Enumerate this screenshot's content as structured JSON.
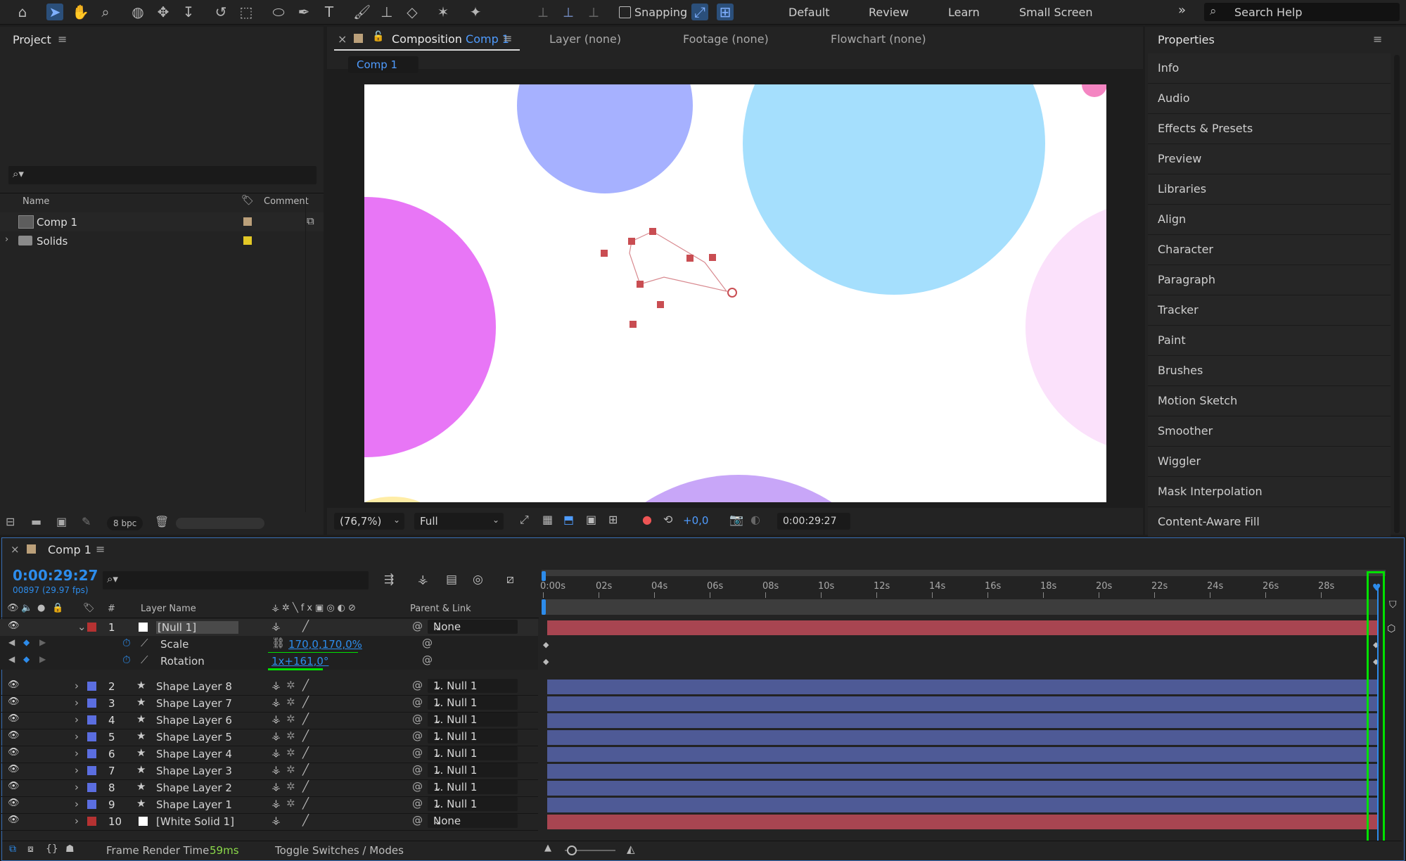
{
  "colors": {
    "accent": "#2d8ceb",
    "null_label": "#b53232",
    "shape_label": "#5b6ee0",
    "bar_red": "#a84551",
    "bar_blue": "#4e5a96",
    "highlight_green": "#00e000"
  },
  "toolbar": {
    "snapping_label": "Snapping",
    "workspaces": [
      "Default",
      "Review",
      "Learn",
      "Small Screen"
    ],
    "search_placeholder": "Search Help"
  },
  "project": {
    "title": "Project",
    "col_name": "Name",
    "col_comment": "Comment",
    "items": [
      {
        "name": "Comp 1",
        "icon": "composition-icon"
      },
      {
        "name": "Solids",
        "icon": "folder-icon"
      }
    ],
    "bpc": "8 bpc"
  },
  "composition": {
    "close": "×",
    "tab_prefix": "Composition",
    "tab_name": "Comp 1",
    "tabs": [
      "Layer (none)",
      "Footage (none)",
      "Flowchart (none)"
    ],
    "breadcrumb": "Comp 1",
    "zoom": "(76,7%)",
    "resolution": "Full",
    "exposure": "+0,0",
    "timecode": "0:00:29:27"
  },
  "properties": {
    "title": "Properties",
    "items": [
      "Info",
      "Audio",
      "Effects & Presets",
      "Preview",
      "Libraries",
      "Align",
      "Character",
      "Paragraph",
      "Tracker",
      "Paint",
      "Brushes",
      "Motion Sketch",
      "Smoother",
      "Wiggler",
      "Mask Interpolation",
      "Content-Aware Fill"
    ]
  },
  "timeline": {
    "close": "×",
    "comp_name": "Comp 1",
    "current_time": "0:00:29:27",
    "frame_info": "00897 (29.97 fps)",
    "col_num": "#",
    "col_layer_name": "Layer Name",
    "col_parent": "Parent & Link",
    "ruler": [
      "0:00s",
      "02s",
      "04s",
      "06s",
      "08s",
      "10s",
      "12s",
      "14s",
      "16s",
      "18s",
      "20s",
      "22s",
      "24s",
      "26s",
      "28s"
    ],
    "scale_label": "Scale",
    "scale_value": "170,0,170,0%",
    "rotation_label": "Rotation",
    "rotation_value": "1x+161,0°",
    "layers": [
      {
        "num": "1",
        "name": "[Null 1]",
        "parent": "None",
        "color": "#b53232"
      },
      {
        "num": "2",
        "name": "Shape Layer 8",
        "parent": "1. Null 1",
        "color": "#5b6ee0"
      },
      {
        "num": "3",
        "name": "Shape Layer 7",
        "parent": "1. Null 1",
        "color": "#5b6ee0"
      },
      {
        "num": "4",
        "name": "Shape Layer 6",
        "parent": "1. Null 1",
        "color": "#5b6ee0"
      },
      {
        "num": "5",
        "name": "Shape Layer 5",
        "parent": "1. Null 1",
        "color": "#5b6ee0"
      },
      {
        "num": "6",
        "name": "Shape Layer 4",
        "parent": "1. Null 1",
        "color": "#5b6ee0"
      },
      {
        "num": "7",
        "name": "Shape Layer 3",
        "parent": "1. Null 1",
        "color": "#5b6ee0"
      },
      {
        "num": "8",
        "name": "Shape Layer 2",
        "parent": "1. Null 1",
        "color": "#5b6ee0"
      },
      {
        "num": "9",
        "name": "Shape Layer 1",
        "parent": "1. Null 1",
        "color": "#5b6ee0"
      },
      {
        "num": "10",
        "name": "[White Solid 1]",
        "parent": "None",
        "color": "#b53232"
      }
    ],
    "render_label": "Frame Render Time",
    "render_value": "59ms",
    "toggle_label": "Toggle Switches / Modes"
  }
}
